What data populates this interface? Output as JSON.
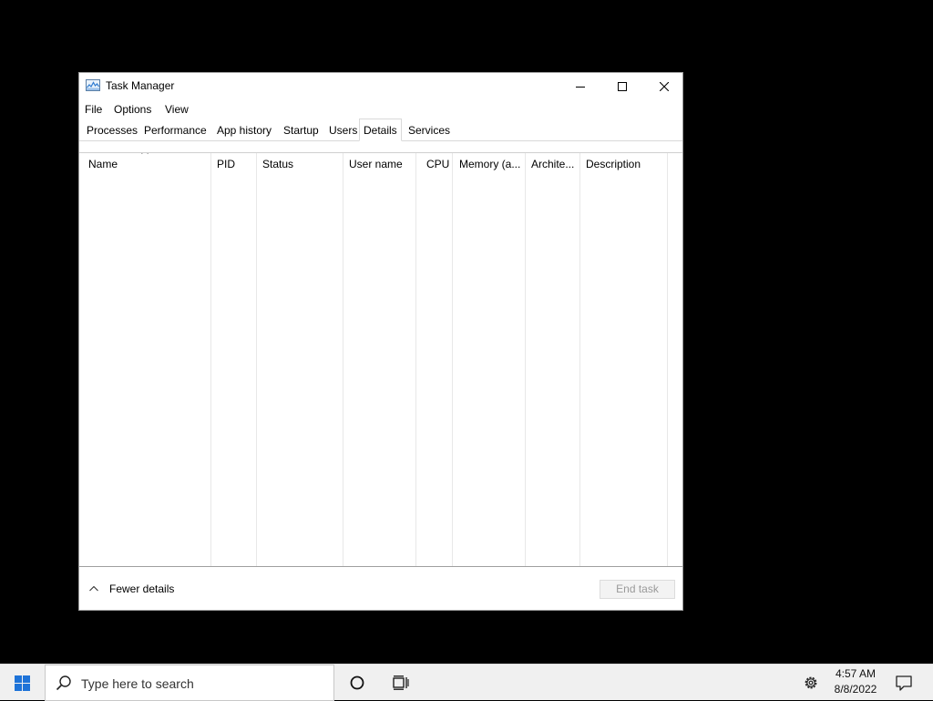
{
  "window": {
    "title": "Task Manager",
    "app_icon": "task-manager-icon",
    "controls": {
      "minimize": "minimize-icon",
      "maximize": "maximize-icon",
      "close": "close-icon"
    }
  },
  "menu": [
    "File",
    "Options",
    "View"
  ],
  "tabs": [
    {
      "label": "Processes",
      "active": false
    },
    {
      "label": "Performance",
      "active": false
    },
    {
      "label": "App history",
      "active": false
    },
    {
      "label": "Startup",
      "active": false
    },
    {
      "label": "Users",
      "active": false
    },
    {
      "label": "Details",
      "active": true
    },
    {
      "label": "Services",
      "active": false
    }
  ],
  "table": {
    "sorted_column": "Name",
    "sort_direction": "ascending",
    "columns": [
      "Name",
      "PID",
      "Status",
      "User name",
      "CPU",
      "Memory (a...",
      "Archite...",
      "Description"
    ],
    "rows": []
  },
  "footer": {
    "fewer_details": "Fewer details",
    "end_task": "End task",
    "end_task_enabled": false
  },
  "taskbar": {
    "start_icon": "windows-logo-icon",
    "search_placeholder": "Type here to search",
    "time": "4:57 AM",
    "date": "8/8/2022"
  }
}
